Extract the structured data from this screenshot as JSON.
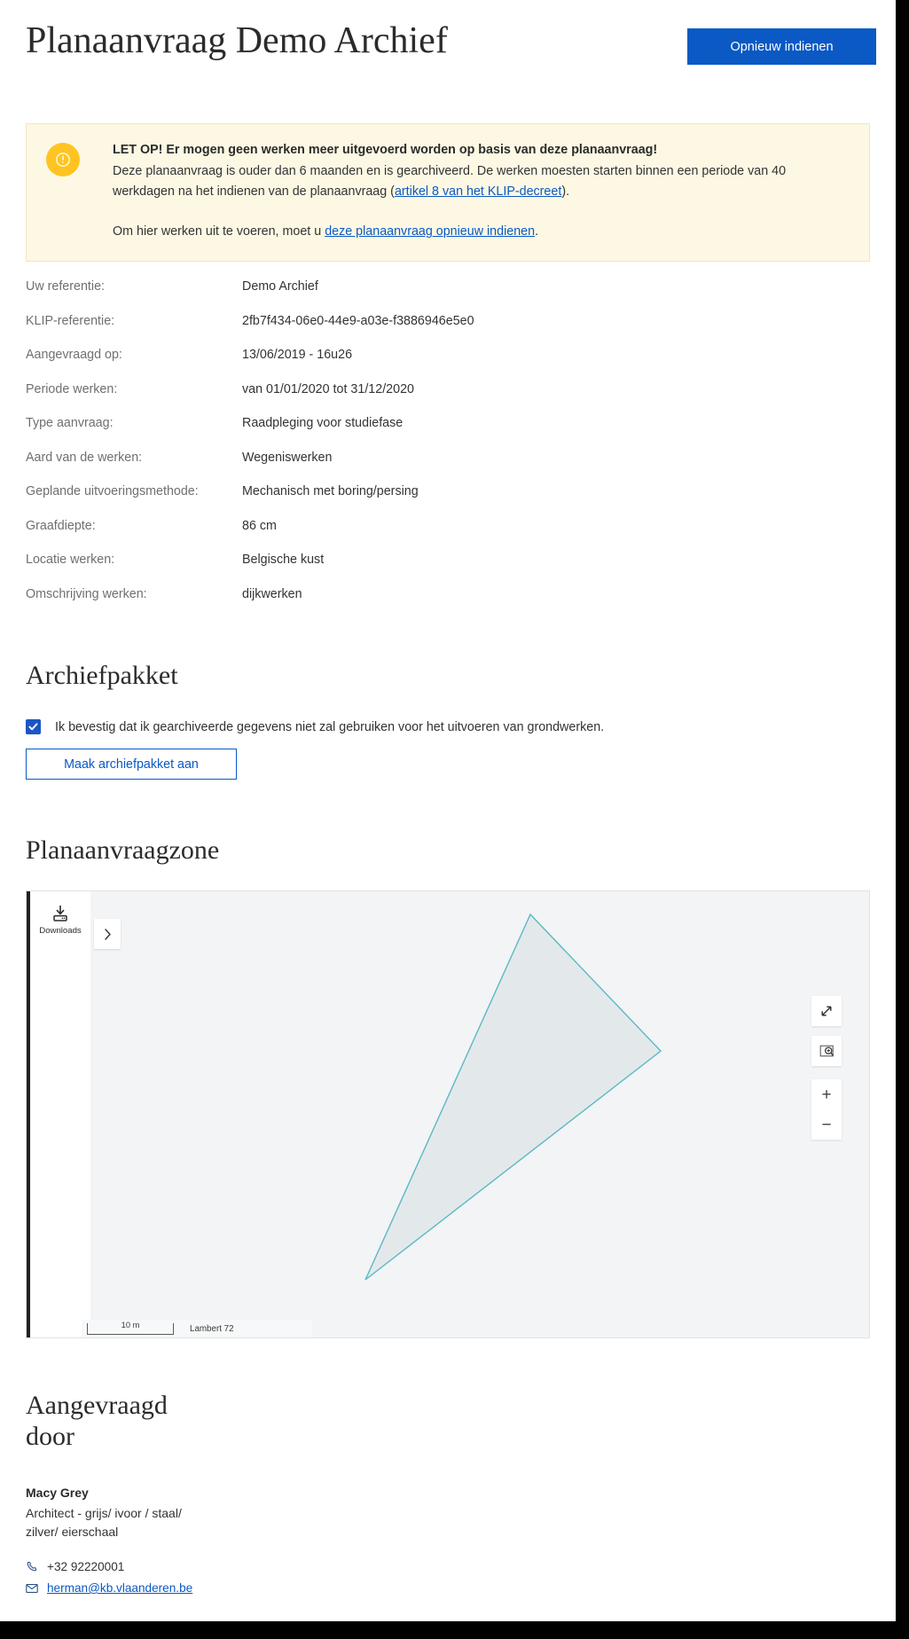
{
  "header": {
    "title": "Planaanvraag Demo Archief",
    "resubmit_label": "Opnieuw indienen"
  },
  "alert": {
    "icon": "exclamation-circle-icon",
    "accent_color": "#ffc421",
    "background_color": "#fdf8e4",
    "title": "LET OP! Er mogen geen werken meer uitgevoerd worden op basis van deze planaanvraag!",
    "body_part1": "Deze planaanvraag is ouder dan 6 maanden en is gearchiveerd. De werken moesten starten binnen een periode van 40 werkdagen na het indienen van de planaanvraag (",
    "body_link": "artikel 8 van het KLIP-decreet",
    "body_part2": ").",
    "second_part1": "Om hier werken uit te voeren, moet u ",
    "second_link": "deze planaanvraag opnieuw indienen",
    "second_part2": "."
  },
  "details": [
    {
      "label": "Uw referentie:",
      "value": "Demo Archief"
    },
    {
      "label": "KLIP-referentie:",
      "value": "2fb7f434-06e0-44e9-a03e-f3886946e5e0"
    },
    {
      "label": "Aangevraagd op:",
      "value": "13/06/2019 - 16u26"
    },
    {
      "label": "Periode werken:",
      "value": "van 01/01/2020 tot 31/12/2020"
    },
    {
      "label": "Type aanvraag:",
      "value": "Raadpleging voor studiefase"
    },
    {
      "label": "Aard van de werken:",
      "value": "Wegeniswerken"
    },
    {
      "label": "Geplande uitvoeringsmethode:",
      "value": "Mechanisch met boring/persing"
    },
    {
      "label": "Graafdiepte:",
      "value": "86 cm"
    },
    {
      "label": "Locatie werken:",
      "value": "Belgische kust"
    },
    {
      "label": "Omschrijving werken:",
      "value": "dijkwerken"
    }
  ],
  "archiefpakket": {
    "heading": "Archiefpakket",
    "checkbox_label": "Ik bevestig dat ik gearchiveerde gegevens niet zal gebruiken voor het uitvoeren van grondwerken.",
    "checkbox_checked": "true",
    "button_label": "Maak archiefpakket aan",
    "accent_color": "#0a59c4"
  },
  "zone": {
    "heading": "Planaanvraagzone",
    "downloads_label": "Downloads",
    "downloads_icon": "download-icon",
    "panel_toggle_icon": "chevron-right-icon",
    "fullscreen_icon": "fullscreen-arrows-icon",
    "extent_icon": "zoom-to-extent-icon",
    "zoom_in_label": "+",
    "zoom_out_label": "−",
    "scale_label": "10 m",
    "projection_label": "Lambert 72",
    "map_background": "#f2f4f6",
    "polygon_stroke": "#5cb8c4",
    "polygon_fill": "#e3e9ea"
  },
  "contact": {
    "heading": "Aangevraagd door",
    "name": "Macy Grey",
    "role": "Architect - grijs/ ivoor / staal/ zilver/ eierschaal",
    "phone_icon": "phone-icon",
    "phone": "+32 92220001",
    "mail_icon": "envelope-icon",
    "email": "herman@kb.vlaanderen.be"
  }
}
